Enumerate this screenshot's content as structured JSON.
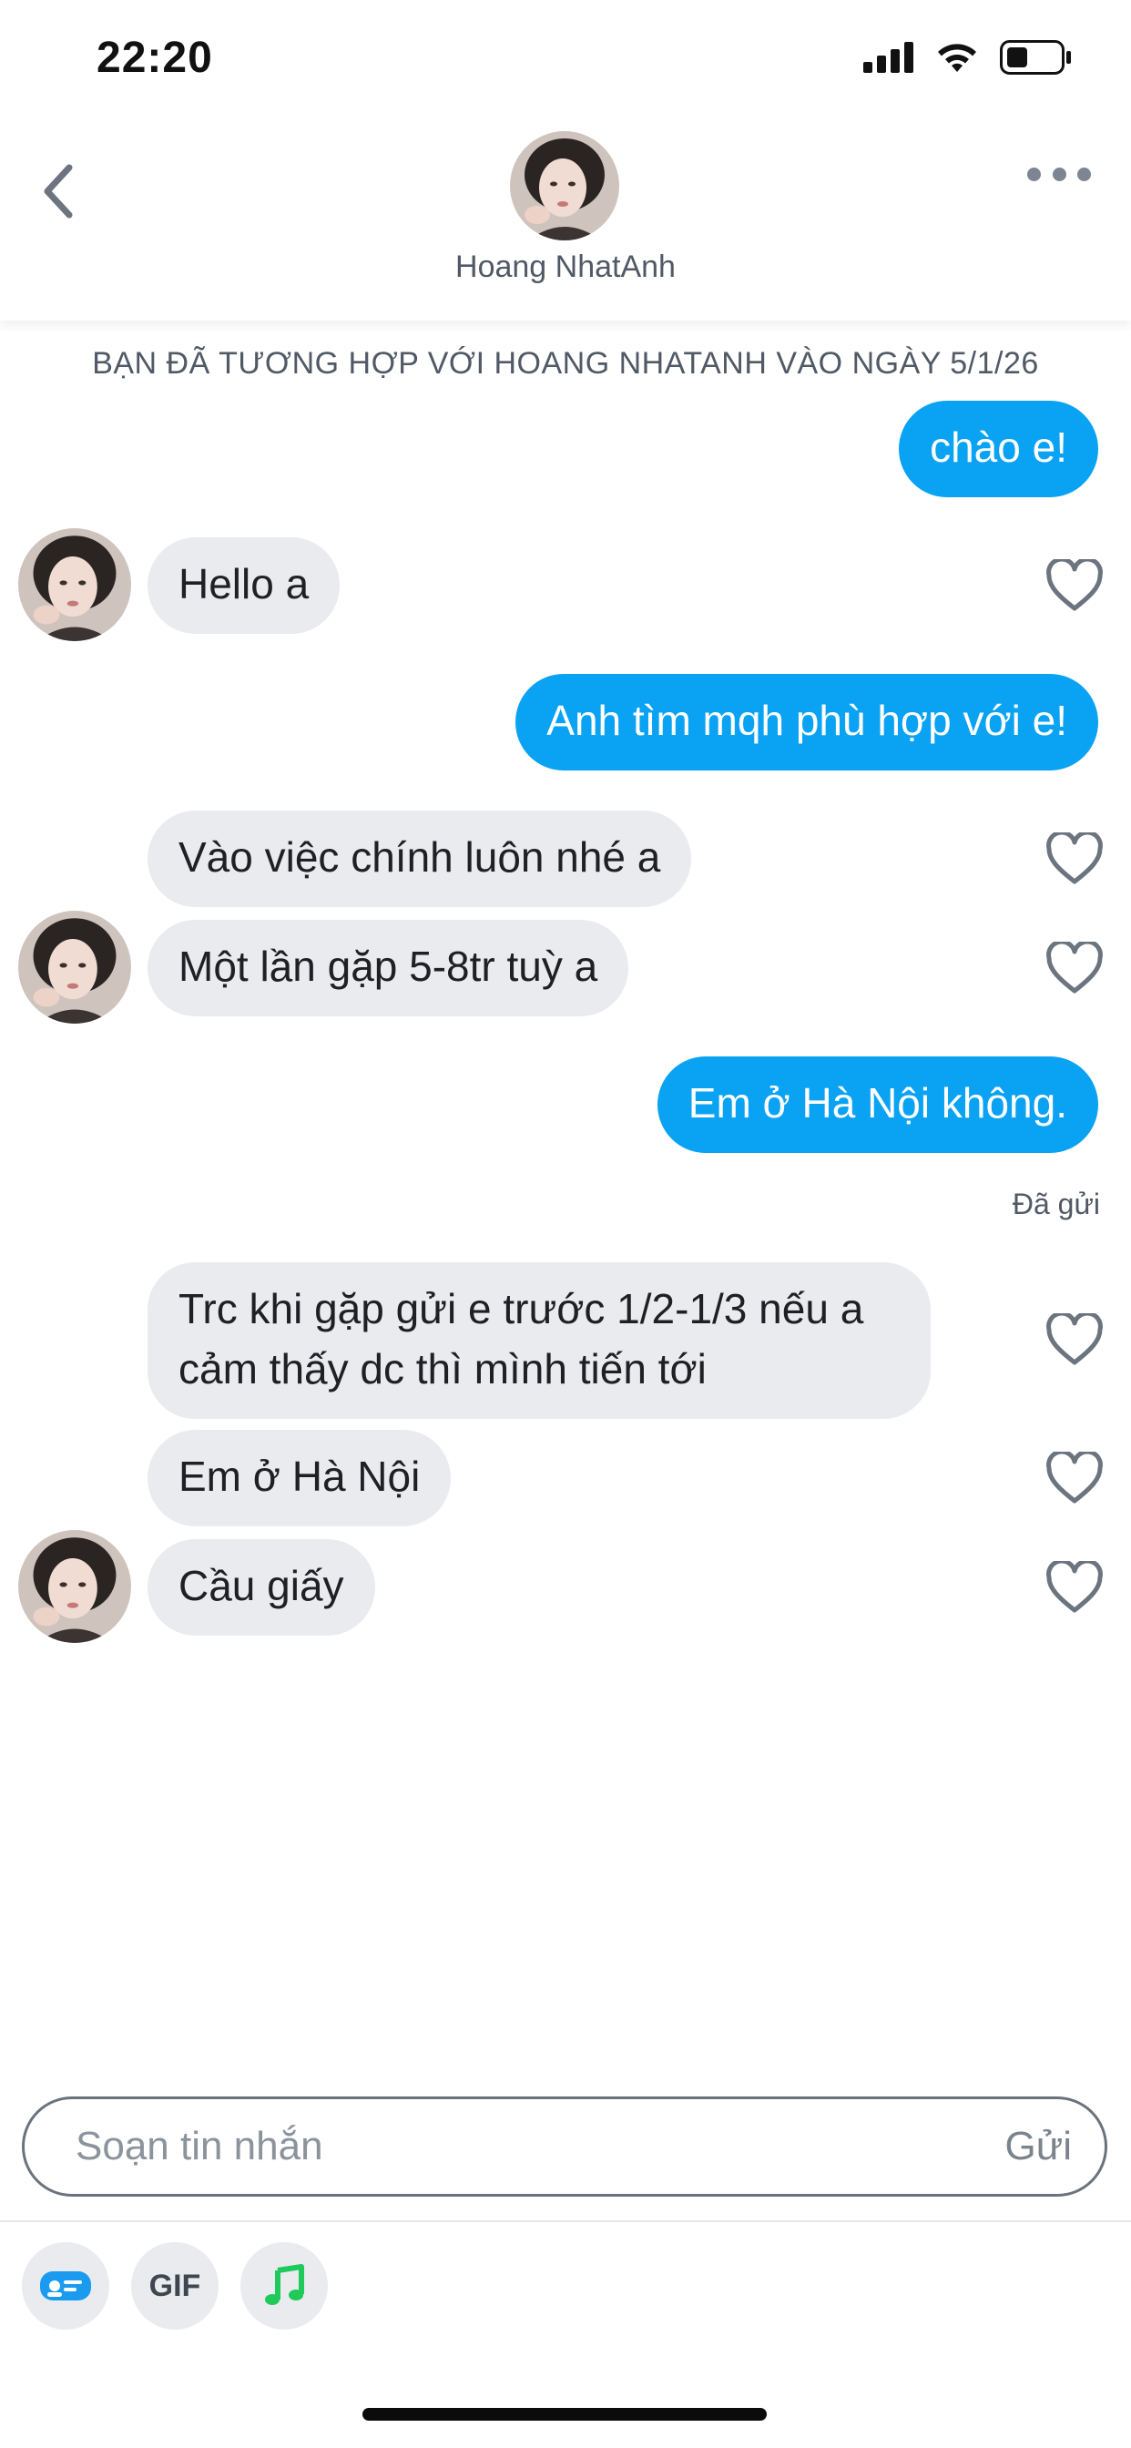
{
  "status_bar": {
    "time": "22:20"
  },
  "header": {
    "name": "Hoang NhatAnh"
  },
  "match_banner": "BẠN ĐÃ TƯƠNG HỢP VỚI HOANG NHATANH VÀO NGÀY 5/1/26",
  "messages": [
    {
      "direction": "out",
      "text": "chào e!"
    },
    {
      "direction": "in",
      "text": "Hello a"
    },
    {
      "direction": "out",
      "text": "Anh tìm mqh phù hợp với e!"
    },
    {
      "direction": "in",
      "text": "Vào việc chính luôn nhé a"
    },
    {
      "direction": "in",
      "text": "Một lần gặp 5-8tr tuỳ a"
    },
    {
      "direction": "out",
      "text": "Em ở Hà Nội không."
    },
    {
      "direction": "in",
      "text": "Trc khi gặp gửi e trước 1/2-1/3 nếu a cảm thấy dc thì mình tiến tới"
    },
    {
      "direction": "in",
      "text": "Em ở Hà Nội"
    },
    {
      "direction": "in",
      "text": "Cầu giấy"
    }
  ],
  "sent_status": "Đã gửi",
  "composer": {
    "placeholder": "Soạn tin nhắn",
    "send_label": "Gửi"
  },
  "toolbar": {
    "gif_label": "GIF"
  },
  "colors": {
    "outgoing_bubble": "#0aa2f2",
    "incoming_bubble": "#e9ebef",
    "music_icon": "#1fc95a",
    "card_icon": "#1a9bf0"
  }
}
